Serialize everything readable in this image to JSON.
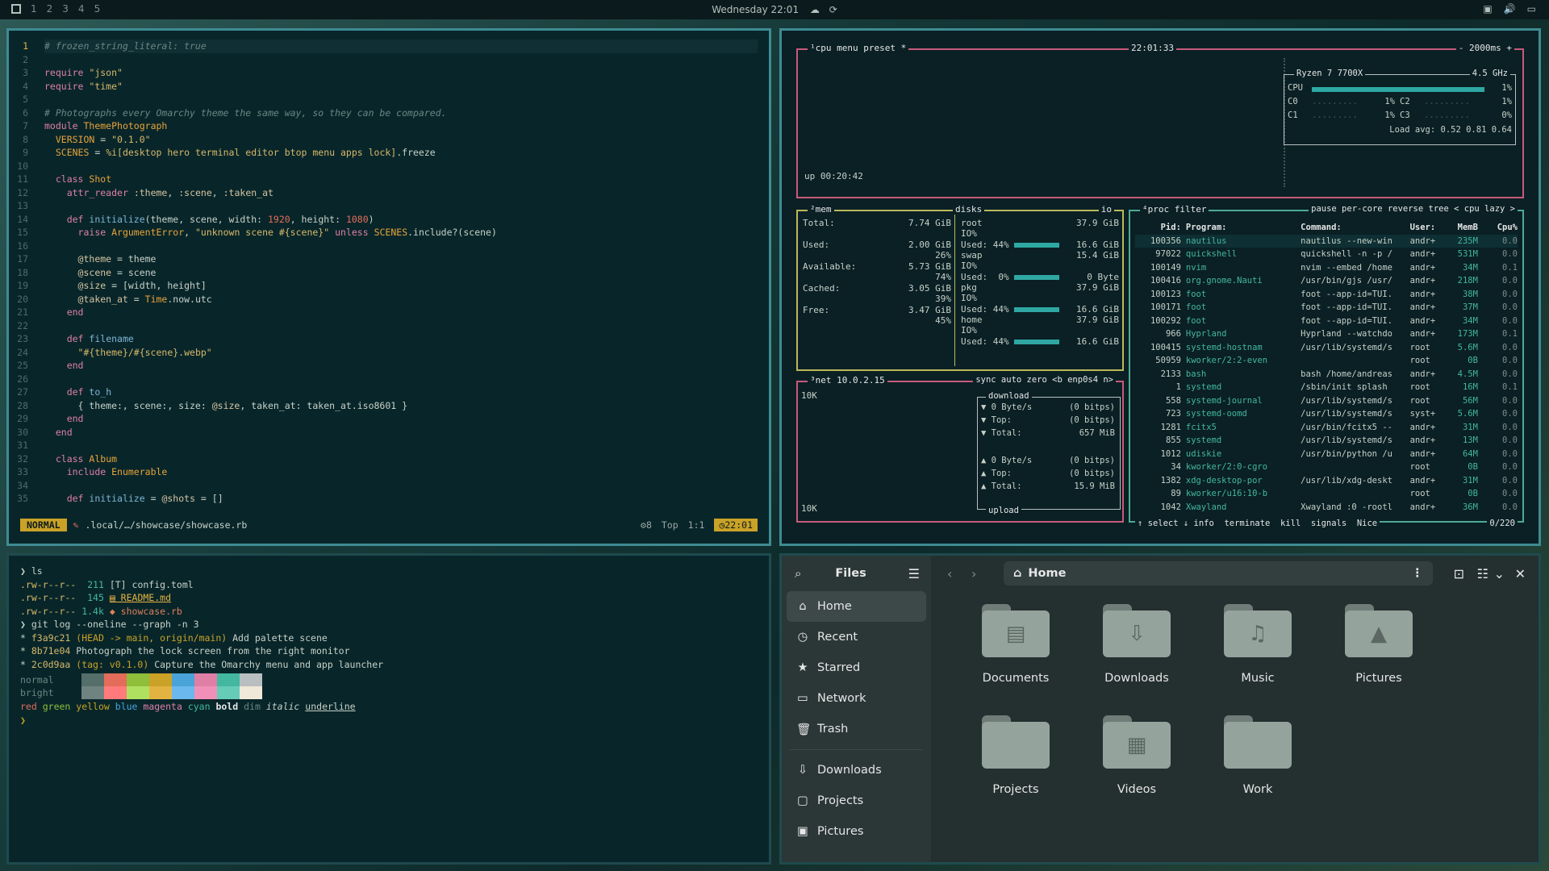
{
  "topbar": {
    "workspaces": [
      "1",
      "2",
      "3",
      "4",
      "5"
    ],
    "datetime": "Wednesday 22:01"
  },
  "editor": {
    "lines": [
      {
        "n": "1",
        "html": "<span class=\"c\"># frozen_string_literal: true</span>"
      },
      {
        "n": "2",
        "html": ""
      },
      {
        "n": "3",
        "html": "<span class=\"k\">require</span> <span class=\"s\">\"json\"</span>"
      },
      {
        "n": "4",
        "html": "<span class=\"k\">require</span> <span class=\"s\">\"time\"</span>"
      },
      {
        "n": "5",
        "html": ""
      },
      {
        "n": "6",
        "html": "<span class=\"c\"># Photographs every Omarchy theme the same way, so they can be compared.</span>"
      },
      {
        "n": "7",
        "html": "<span class=\"k\">module</span> <span class=\"t\">ThemePhotograph</span>"
      },
      {
        "n": "8",
        "html": "  <span class=\"t\">VERSION</span> = <span class=\"s\">\"0.1.0\"</span>"
      },
      {
        "n": "9",
        "html": "  <span class=\"t\">SCENES</span> = <span class=\"s\">%i[desktop hero terminal editor btop menu apps lock]</span>.freeze"
      },
      {
        "n": "10",
        "html": ""
      },
      {
        "n": "11",
        "html": "  <span class=\"k\">class</span> <span class=\"t\">Shot</span>"
      },
      {
        "n": "12",
        "html": "    <span class=\"k\">attr_reader</span> <span class=\"sym\">:theme</span>, <span class=\"sym\">:scene</span>, <span class=\"sym\">:taken_at</span>"
      },
      {
        "n": "13",
        "html": ""
      },
      {
        "n": "14",
        "html": "    <span class=\"k\">def</span> <span class=\"f\">initialize</span>(theme, scene, width: <span class=\"n\">1920</span>, height: <span class=\"n\">1080</span>)"
      },
      {
        "n": "15",
        "html": "      <span class=\"k\">raise</span> <span class=\"t\">ArgumentError</span>, <span class=\"s\">\"unknown scene #{scene}\"</span> <span class=\"k\">unless</span> <span class=\"t\">SCENES</span>.include?(scene)"
      },
      {
        "n": "16",
        "html": ""
      },
      {
        "n": "17",
        "html": "      <span class=\"sym\">@theme</span> = theme"
      },
      {
        "n": "18",
        "html": "      <span class=\"sym\">@scene</span> = scene"
      },
      {
        "n": "19",
        "html": "      <span class=\"sym\">@size</span> = [width, height]"
      },
      {
        "n": "20",
        "html": "      <span class=\"sym\">@taken_at</span> = <span class=\"t\">Time</span>.now.utc"
      },
      {
        "n": "21",
        "html": "    <span class=\"k\">end</span>"
      },
      {
        "n": "22",
        "html": ""
      },
      {
        "n": "23",
        "html": "    <span class=\"k\">def</span> <span class=\"f\">filename</span>"
      },
      {
        "n": "24",
        "html": "      <span class=\"s\">\"#{theme}/#{scene}.webp\"</span>"
      },
      {
        "n": "25",
        "html": "    <span class=\"k\">end</span>"
      },
      {
        "n": "26",
        "html": ""
      },
      {
        "n": "27",
        "html": "    <span class=\"k\">def</span> <span class=\"f\">to_h</span>"
      },
      {
        "n": "28",
        "html": "      { theme:, scene:, size: <span class=\"sym\">@size</span>, taken_at: taken_at.iso8601 }"
      },
      {
        "n": "29",
        "html": "    <span class=\"k\">end</span>"
      },
      {
        "n": "30",
        "html": "  <span class=\"k\">end</span>"
      },
      {
        "n": "31",
        "html": ""
      },
      {
        "n": "32",
        "html": "  <span class=\"k\">class</span> <span class=\"t\">Album</span>"
      },
      {
        "n": "33",
        "html": "    <span class=\"k\">include</span> <span class=\"t\">Enumerable</span>"
      },
      {
        "n": "34",
        "html": ""
      },
      {
        "n": "35",
        "html": "    <span class=\"k\">def</span> <span class=\"f\">initialize</span> = <span class=\"sym\">@shots</span> = []"
      }
    ],
    "status": {
      "mode": "NORMAL",
      "file": ".local/…/showcase/showcase.rb",
      "lsp": "8",
      "pos": "Top",
      "cursor": "1:1",
      "time": "22:01"
    }
  },
  "btop": {
    "cpu_header": "¹cpu menu preset *",
    "clock": "22:01:33",
    "interval": "2000ms",
    "cpu_name": "Ryzen 7 7700X",
    "freq": "4.5 GHz",
    "cpu_total_label": "CPU",
    "cpu_total": "1%",
    "cores": [
      {
        "name": "C0",
        "val": "1%"
      },
      {
        "name": "C2",
        "val": "1%"
      },
      {
        "name": "C1",
        "val": "1%"
      },
      {
        "name": "C3",
        "val": "0%"
      }
    ],
    "load_avg": "Load avg: 0.52 0.81 0.64",
    "uptime": "up 00:20:42",
    "mem": {
      "header": "²mem",
      "rows": [
        {
          "label": "Total:",
          "val": "7.74 GiB"
        },
        {
          "label": "Used:",
          "val": "2.00 GiB",
          "pct": "26%"
        },
        {
          "label": "Available:",
          "val": "5.73 GiB",
          "pct": "74%"
        },
        {
          "label": "Cached:",
          "val": "3.05 GiB",
          "pct": "39%"
        },
        {
          "label": "Free:",
          "val": "3.47 GiB",
          "pct": "45%"
        }
      ]
    },
    "disks": {
      "header": "disks",
      "io": "io",
      "items": [
        {
          "name": "root",
          "size": "37.9 GiB",
          "used": "Used: 44%",
          "val": "16.6 GiB"
        },
        {
          "name": "swap",
          "size": "15.4 GiB",
          "used": "Used:  0%",
          "val": "0 Byte"
        },
        {
          "name": "pkg",
          "size": "37.9 GiB",
          "used": "Used: 44%",
          "val": "16.6 GiB"
        },
        {
          "name": "home",
          "size": "37.9 GiB",
          "used": "Used: 44%",
          "val": "16.6 GiB"
        }
      ]
    },
    "net": {
      "header": "³net",
      "ip": "10.0.2.15",
      "opts": "sync auto zero <b enp0s4 n>",
      "scale_top": "10K",
      "scale_bottom": "10K",
      "download": "download",
      "upload": "upload",
      "down_rows": [
        {
          "k": "▼ 0 Byte/s",
          "v": "(0 bitps)"
        },
        {
          "k": "▼ Top:",
          "v": "(0 bitps)"
        },
        {
          "k": "▼ Total:",
          "v": "657 MiB"
        }
      ],
      "up_rows": [
        {
          "k": "▲ 0 Byte/s",
          "v": "(0 bitps)"
        },
        {
          "k": "▲ Top:",
          "v": "(0 bitps)"
        },
        {
          "k": "▲ Total:",
          "v": "15.9 MiB"
        }
      ]
    },
    "proc": {
      "header": "⁴proc filter",
      "opts": "pause per-core reverse tree < cpu lazy >",
      "cols": [
        "Pid:",
        "Program:",
        "Command:",
        "User:",
        "MemB",
        "Cpu%"
      ],
      "rows": [
        [
          "100356",
          "nautilus",
          "nautilus --new-win",
          "andr+",
          "235M",
          "0.0"
        ],
        [
          "97022",
          "quickshell",
          "quickshell -n -p /",
          "andr+",
          "531M",
          "0.0"
        ],
        [
          "100149",
          "nvim",
          "nvim --embed /home",
          "andr+",
          "34M",
          "0.1"
        ],
        [
          "100416",
          "org.gnome.Nauti",
          "/usr/bin/gjs /usr/",
          "andr+",
          "218M",
          "0.0"
        ],
        [
          "100123",
          "foot",
          "foot --app-id=TUI.",
          "andr+",
          "38M",
          "0.0"
        ],
        [
          "100171",
          "foot",
          "foot --app-id=TUI.",
          "andr+",
          "37M",
          "0.0"
        ],
        [
          "100292",
          "foot",
          "foot --app-id=TUI.",
          "andr+",
          "34M",
          "0.0"
        ],
        [
          "966",
          "Hyprland",
          "Hyprland --watchdo",
          "andr+",
          "173M",
          "0.1"
        ],
        [
          "100415",
          "systemd-hostnam",
          "/usr/lib/systemd/s",
          "root",
          "5.6M",
          "0.0"
        ],
        [
          "50959",
          "kworker/2:2-even",
          "",
          "root",
          "0B",
          "0.0"
        ],
        [
          "2133",
          "bash",
          "bash /home/andreas",
          "andr+",
          "4.5M",
          "0.0"
        ],
        [
          "1",
          "systemd",
          "/sbin/init splash",
          "root",
          "16M",
          "0.1"
        ],
        [
          "558",
          "systemd-journal",
          "/usr/lib/systemd/s",
          "root",
          "56M",
          "0.0"
        ],
        [
          "723",
          "systemd-oomd",
          "/usr/lib/systemd/s",
          "syst+",
          "5.6M",
          "0.0"
        ],
        [
          "1281",
          "fcitx5",
          "/usr/bin/fcitx5 --",
          "andr+",
          "31M",
          "0.0"
        ],
        [
          "855",
          "systemd",
          "/usr/lib/systemd/s",
          "andr+",
          "13M",
          "0.0"
        ],
        [
          "1012",
          "udiskie",
          "/usr/bin/python /u",
          "andr+",
          "64M",
          "0.0"
        ],
        [
          "34",
          "kworker/2:0-cgro",
          "",
          "root",
          "0B",
          "0.0"
        ],
        [
          "1382",
          "xdg-desktop-por",
          "/usr/lib/xdg-deskt",
          "andr+",
          "31M",
          "0.0"
        ],
        [
          "89",
          "kworker/u16:10-b",
          "",
          "root",
          "0B",
          "0.0"
        ],
        [
          "1042",
          "Xwayland",
          "Xwayland :0 -rootl",
          "andr+",
          "36M",
          "0.0"
        ]
      ],
      "footer": "↑ select ↓ info  terminate  kill  signals  Nice",
      "count": "0/220"
    }
  },
  "terminal": {
    "lines": [
      "<span style=\"color:#c8d1c8\">❯ ls</span>",
      "<span style=\"color:#d7b86a\">.rw-r--r--</span>  <span style=\"color:#44b7a0\">211</span> <span style=\"color:#c8d1c8\">[T] config.toml</span>",
      "<span style=\"color:#d7b86a\">.rw-r--r--</span>  <span style=\"color:#44b7a0\">145</span> <span style=\"color:#e3b341;text-decoration:underline\">▤ README.md</span>",
      "<span style=\"color:#d7b86a\">.rw-r--r--</span> <span style=\"color:#44b7a0\">1.4k</span> <span style=\"color:#e07f5a\">◆ showcase.rb</span>",
      "<span style=\"color:#c8d1c8\">❯ git log --oneline --graph -n 3</span>",
      "<span style=\"color:#c8d1c8\">* <span style=\"color:#d7b86a\">f3a9c21</span> <span style=\"color:#c9a227\">(HEAD -&gt; main, origin/main)</span> Add palette scene</span>",
      "<span style=\"color:#c8d1c8\">* <span style=\"color:#d7b86a\">8b71e04</span> Photograph the lock screen from the right monitor</span>",
      "<span style=\"color:#c8d1c8\">* <span style=\"color:#d7b86a\">2c0d9aa</span> <span style=\"color:#c9a227\">(tag: v0.1.0)</span> Capture the Omarchy menu and app launcher</span>"
    ],
    "palette_normal_label": "normal",
    "palette_bright_label": "bright",
    "palette_normal": [
      "#566e6a",
      "#e36d5a",
      "#8fbf3a",
      "#c9a227",
      "#4aa3d8",
      "#e07fa6",
      "#44b7a0",
      "#b9bfc0"
    ],
    "palette_bright": [
      "#6f8480",
      "#ff7a7a",
      "#b0e060",
      "#e3b341",
      "#6ab8ee",
      "#f090b8",
      "#66ccb8",
      "#f0e8d8"
    ],
    "styles_line": "<span style=\"color:#e36d5a\">red</span> <span style=\"color:#8fbf3a\">green</span> <span style=\"color:#c9a227\">yellow</span> <span style=\"color:#4aa3d8\">blue</span> <span style=\"color:#e07fa6\">magenta</span> <span style=\"color:#44b7a0\">cyan</span> <span style=\"font-weight:bold;color:#e6e6e6\">bold</span> <span style=\"color:#6c8583\">dim</span> <span style=\"font-style:italic;color:#c8d1c8\">italic</span> <span style=\"text-decoration:underline;color:#c8d1c8\">underline</span>",
    "prompt": "❯"
  },
  "files": {
    "title": "Files",
    "path": "Home",
    "sidebar": [
      {
        "label": "Home",
        "icon": "⌂",
        "active": true
      },
      {
        "label": "Recent",
        "icon": "◷"
      },
      {
        "label": "Starred",
        "icon": "★"
      },
      {
        "label": "Network",
        "icon": "▭"
      },
      {
        "label": "Trash",
        "icon": "🗑"
      }
    ],
    "bookmarks": [
      {
        "label": "Downloads",
        "icon": "⇩"
      },
      {
        "label": "Projects",
        "icon": "▢"
      },
      {
        "label": "Pictures",
        "icon": "▣"
      }
    ],
    "folders": [
      {
        "label": "Documents",
        "glyph": "▤"
      },
      {
        "label": "Downloads",
        "glyph": "⇩"
      },
      {
        "label": "Music",
        "glyph": "♫"
      },
      {
        "label": "Pictures",
        "glyph": "▲"
      },
      {
        "label": "Projects",
        "glyph": ""
      },
      {
        "label": "Videos",
        "glyph": "▦"
      },
      {
        "label": "Work",
        "glyph": ""
      }
    ]
  }
}
